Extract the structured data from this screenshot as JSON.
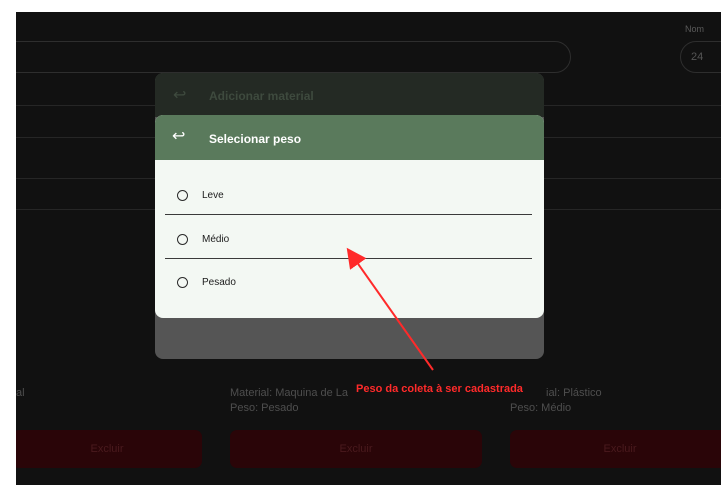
{
  "top": {
    "label": "Nom",
    "pill_value": "24"
  },
  "cards": [
    {
      "material_text": "al",
      "weight_text": "",
      "delete_label": "Excluir"
    },
    {
      "material_text": "Material: Maquina de La",
      "weight_text": "Peso: Pesado",
      "delete_label": "Excluir"
    },
    {
      "material_text": "ial: Plástico",
      "weight_text": "Peso: Médio",
      "delete_label": "Excluir"
    }
  ],
  "background_dialog": {
    "back_icon": "return-arrow-icon",
    "title": "Adicionar material"
  },
  "dialog": {
    "back_icon": "return-arrow-icon",
    "title": "Selecionar peso",
    "options": [
      {
        "label": "Leve"
      },
      {
        "label": "Médio"
      },
      {
        "label": "Pesado"
      }
    ]
  },
  "annotation": {
    "text": "Peso da coleta à ser cadastrada",
    "color": "#ff2a2a"
  },
  "colors": {
    "header_green": "#5a7a5c",
    "dialog_bg": "#f3f8f3",
    "delete_button": "#2a0508"
  }
}
